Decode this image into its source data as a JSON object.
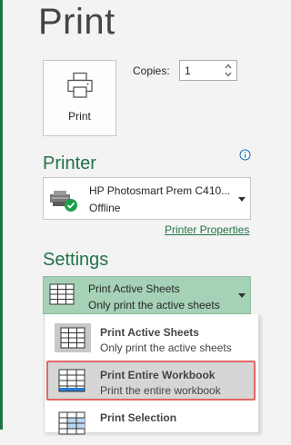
{
  "page": {
    "title": "Print"
  },
  "print_button": {
    "label": "Print",
    "icon": "printer-icon"
  },
  "copies": {
    "label": "Copies:",
    "value": "1"
  },
  "printer": {
    "heading": "Printer",
    "info_icon": "info-icon",
    "selected_name": "HP Photosmart Prem C410...",
    "selected_status": "Offline",
    "properties_link": "Printer Properties"
  },
  "settings": {
    "heading": "Settings",
    "selected_title": "Print Active Sheets",
    "selected_subtitle": "Only print the active sheets",
    "options": [
      {
        "title": "Print Active Sheets",
        "subtitle": "Only print the active sheets"
      },
      {
        "title": "Print Entire Workbook",
        "subtitle": "Print the entire workbook"
      },
      {
        "title": "Print Selection",
        "subtitle": ""
      }
    ]
  },
  "colors": {
    "accent": "#217346",
    "selected_bg": "#a5d1b6",
    "hover_bg": "#d6d6d6",
    "highlight_border": "#e06666"
  }
}
